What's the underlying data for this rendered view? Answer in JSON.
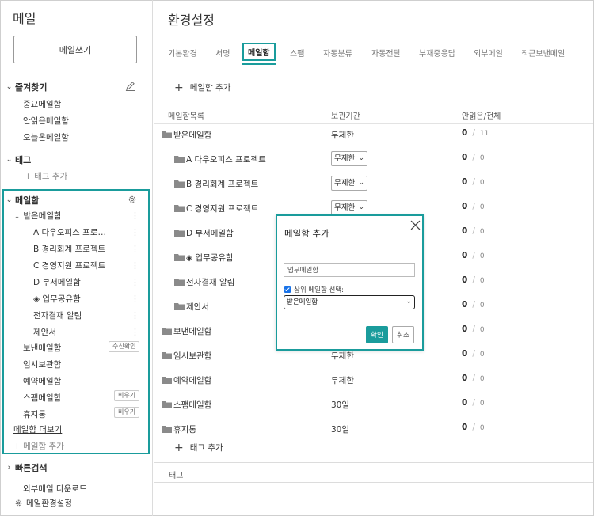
{
  "sidebar": {
    "title": "메일",
    "compose_label": "메일쓰기",
    "favorites": {
      "label": "즐겨찾기",
      "items": [
        "중요메일함",
        "안읽은메일함",
        "오늘온메일함"
      ]
    },
    "tags": {
      "label": "태그",
      "add_label": "태그 추가"
    },
    "mailboxes": {
      "label": "메일함",
      "inbox_label": "받은메일함",
      "inbox_children": [
        "A 다우오피스 프로…",
        "B 경리회계 프로젝트",
        "C 경영지원 프로젝트",
        "D 부서메일함",
        "◈ 업무공유함",
        "전자결재 알림",
        "제안서"
      ],
      "sent_label": "보낸메일함",
      "sent_badge": "수신확인",
      "temp_label": "임시보관함",
      "reserved_label": "예약메일함",
      "spam_label": "스팸메일함",
      "spam_badge": "비우기",
      "trash_label": "휴지통",
      "trash_badge": "비우기",
      "more_label": "메일함 더보기",
      "add_label": "메일함 추가"
    },
    "quick_search_label": "빠른검색",
    "external_download_label": "외부메일 다운로드",
    "settings_label": "메일환경설정"
  },
  "main": {
    "title": "환경설정",
    "tabs": [
      "기본환경",
      "서명",
      "메일함",
      "스팸",
      "자동분류",
      "자동전달",
      "부재중응답",
      "외부메일",
      "최근보낸메일"
    ],
    "active_tab": "메일함",
    "add_mailbox_label": "메일함 추가",
    "columns": [
      "메일함목록",
      "보관기간",
      "안읽은/전체"
    ],
    "rows": [
      {
        "name": "받은메일함",
        "period": "무제한",
        "select": false,
        "unread": "0",
        "total": "11",
        "indent": 0
      },
      {
        "name": "A 다우오피스 프로젝트",
        "period": "무제한",
        "select": true,
        "unread": "0",
        "total": "0",
        "indent": 1
      },
      {
        "name": "B 경리회계 프로젝트",
        "period": "무제한",
        "select": true,
        "unread": "0",
        "total": "0",
        "indent": 1
      },
      {
        "name": "C 경영지원 프로젝트",
        "period": "무제한",
        "select": true,
        "unread": "0",
        "total": "0",
        "indent": 1
      },
      {
        "name": "D 부서메일함",
        "period": "",
        "select": false,
        "unread": "0",
        "total": "0",
        "indent": 1
      },
      {
        "name": "◈ 업무공유함",
        "period": "",
        "select": false,
        "unread": "0",
        "total": "0",
        "indent": 1
      },
      {
        "name": "전자결재 알림",
        "period": "",
        "select": false,
        "unread": "0",
        "total": "0",
        "indent": 1
      },
      {
        "name": "제안서",
        "period": "",
        "select": false,
        "unread": "0",
        "total": "0",
        "indent": 1
      },
      {
        "name": "보낸메일함",
        "period": "",
        "select": false,
        "unread": "0",
        "total": "0",
        "indent": 0
      },
      {
        "name": "임시보관함",
        "period": "무제한",
        "select": false,
        "unread": "0",
        "total": "0",
        "indent": 0
      },
      {
        "name": "예약메일함",
        "period": "무제한",
        "select": false,
        "unread": "0",
        "total": "0",
        "indent": 0
      },
      {
        "name": "스팸메일함",
        "period": "30일",
        "select": false,
        "unread": "0",
        "total": "0",
        "indent": 0
      },
      {
        "name": "휴지통",
        "period": "30일",
        "select": false,
        "unread": "0",
        "total": "0",
        "indent": 0
      }
    ],
    "tag_add_label": "태그 추가",
    "tag_section_label": "태그"
  },
  "dialog": {
    "title": "메일함 추가",
    "input_value": "업무메일함",
    "checkbox_label": "상위 메일함 선택:",
    "select_value": "받은메일함",
    "confirm_label": "확인",
    "cancel_label": "취소"
  },
  "colors": {
    "accent": "#1a9c9c",
    "checkbox": "#1a73e8"
  },
  "icons": [
    "pencil-icon",
    "gear-icon",
    "folder-icon",
    "close-icon",
    "plus-icon",
    "chevron-down-icon",
    "chevron-right-icon",
    "kebab-icon"
  ]
}
